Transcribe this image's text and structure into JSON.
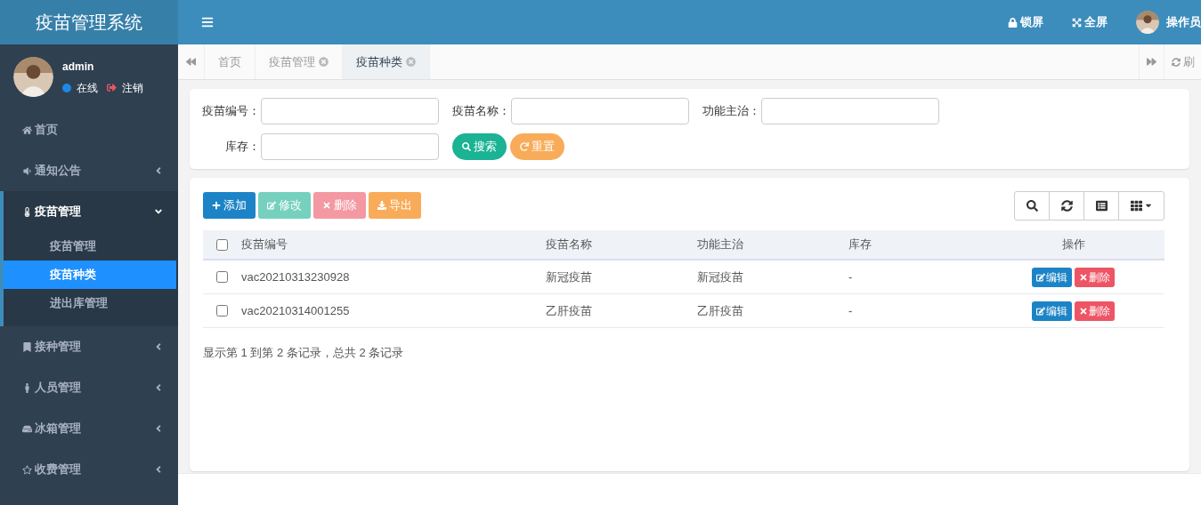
{
  "app_title": "疫苗管理系统",
  "user": {
    "name": "admin",
    "status": "在线",
    "logout": "注销"
  },
  "menu": [
    {
      "label": "首页",
      "expanded": false,
      "has_children": false
    },
    {
      "label": "通知公告",
      "expanded": false,
      "has_children": true
    },
    {
      "label": "疫苗管理",
      "expanded": true,
      "has_children": true,
      "children": [
        {
          "label": "疫苗管理",
          "selected": false
        },
        {
          "label": "疫苗种类",
          "selected": true
        },
        {
          "label": "进出库管理",
          "selected": false
        }
      ]
    },
    {
      "label": "接种管理",
      "expanded": false,
      "has_children": true
    },
    {
      "label": "人员管理",
      "expanded": false,
      "has_children": true
    },
    {
      "label": "冰箱管理",
      "expanded": false,
      "has_children": true
    },
    {
      "label": "收费管理",
      "expanded": false,
      "has_children": true
    }
  ],
  "header_actions": [
    {
      "label": "锁屏"
    },
    {
      "label": "全屏"
    }
  ],
  "operator": "操作员",
  "tabs": [
    {
      "label": "首页",
      "selected": false,
      "closable": false
    },
    {
      "label": "疫苗管理",
      "selected": false,
      "closable": true
    },
    {
      "label": "疫苗种类",
      "selected": true,
      "closable": true
    }
  ],
  "refresh": "刷",
  "search_form": {
    "fields": [
      {
        "label": "疫苗编号："
      },
      {
        "label": "疫苗名称："
      },
      {
        "label": "功能主治："
      },
      {
        "label": "库存："
      }
    ],
    "search": "搜索",
    "reset": "重置"
  },
  "toolbar": [
    {
      "label": "添加",
      "kind": "add",
      "disabled": false
    },
    {
      "label": "修改",
      "kind": "edit",
      "disabled": true
    },
    {
      "label": "删除",
      "kind": "delete",
      "disabled": true
    },
    {
      "label": "导出",
      "kind": "export",
      "disabled": false
    }
  ],
  "table": {
    "all_checked": false,
    "columns": [
      "疫苗编号",
      "疫苗名称",
      "功能主治",
      "库存",
      "操作"
    ],
    "rows": [
      {
        "checked": false,
        "cells": [
          "vac20210313230928",
          "新冠疫苗",
          "新冠疫苗",
          "-"
        ],
        "actions": [
          "编辑",
          "删除"
        ]
      },
      {
        "checked": false,
        "cells": [
          "vac20210314001255",
          "乙肝疫苗",
          "乙肝疫苗",
          "-"
        ],
        "actions": [
          "编辑",
          "删除"
        ]
      }
    ]
  },
  "summary": "显示第 1 到第 2 条记录，总共 2 条记录"
}
